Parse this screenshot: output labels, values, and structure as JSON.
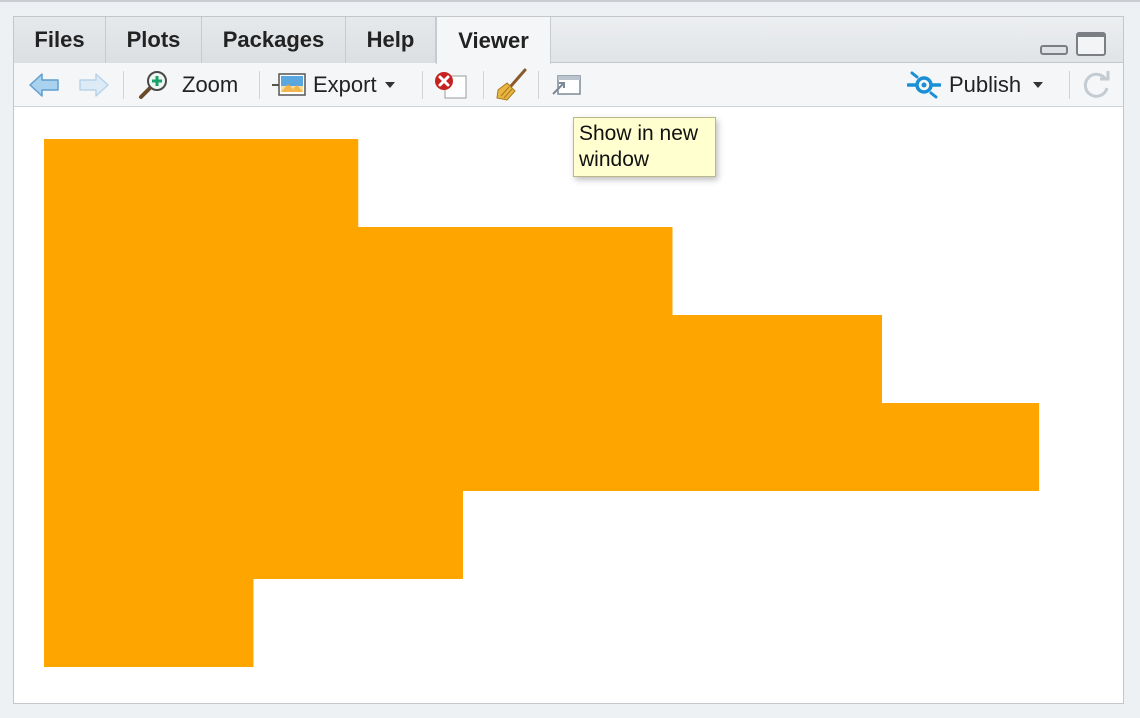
{
  "tabs": [
    {
      "label": "Files",
      "active": false
    },
    {
      "label": "Plots",
      "active": false
    },
    {
      "label": "Packages",
      "active": false
    },
    {
      "label": "Help",
      "active": false
    },
    {
      "label": "Viewer",
      "active": true
    }
  ],
  "toolbar": {
    "zoom_label": "Zoom",
    "export_label": "Export",
    "publish_label": "Publish",
    "icons": [
      "back-arrow-icon",
      "forward-arrow-icon",
      "zoom-icon",
      "export-image-icon",
      "remove-viewer-icon",
      "broom-icon",
      "show-in-new-window-icon",
      "publish-icon",
      "refresh-icon"
    ]
  },
  "tooltip": {
    "text": "Show in new\nwindow"
  },
  "viewer": {
    "fill_color": "#FFA500",
    "rows": [
      1.5,
      3.0,
      4.0,
      4.75,
      2.0,
      1.0
    ]
  },
  "colors": {
    "accent": "#1a8fd6",
    "bar": "#FFA500"
  }
}
